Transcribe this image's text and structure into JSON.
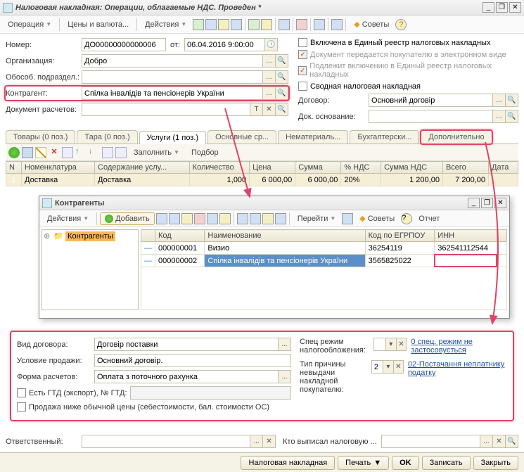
{
  "win": {
    "title": "Налоговая накладная: Операции, облагаемые НДС. Проведен *",
    "min": "_",
    "rest": "❐",
    "close": "✕"
  },
  "tb1": {
    "operation": "Операция",
    "prices": "Цены и валюта...",
    "actions": "Действия",
    "tips": "Советы"
  },
  "hdr": {
    "number_l": "Номер:",
    "number": "ДО00000000000006",
    "from_l": "от:",
    "from": "06.04.2016  9:00:00",
    "org_l": "Организация:",
    "org": "Добро",
    "obosob_l": "Обособ. подраздел.:",
    "obosob": "",
    "contr_l": "Контрагент:",
    "contr": "Спілка інвалідів та пенсіонерів України",
    "docr_l": "Документ расчетов:",
    "docr": "",
    "cb1": "Включена в Единый реестр налоговых накладных",
    "cb2": "Документ передается покупателю в электронном виде",
    "cb3": "Подлежит включению в Единый реестр налоговых накладных",
    "cb4": "Сводная налоговая накладная",
    "dog_l": "Договор:",
    "dog": "Основний договір",
    "doco_l": "Док. основание:",
    "doco": ""
  },
  "tabs": {
    "t1": "Товары (0 поз.)",
    "t2": "Тара (0 поз.)",
    "t3": "Услуги (1 поз.)",
    "t4": "Основные ср...",
    "t5": "Нематериаль...",
    "t6": "Бухгалтерски...",
    "t7": "Дополнительно"
  },
  "gbar": {
    "fill": "Заполнить",
    "sel": "Подбор"
  },
  "gh": {
    "n": "N",
    "nom": "Номенклатура",
    "cont": "Содержание услу...",
    "qty": "Количество",
    "price": "Цена",
    "sum": "Сумма",
    "vat": "% НДС",
    "vats": "Сумма НДС",
    "total": "Всего",
    "date": "Дата"
  },
  "gr": {
    "n": "1",
    "nom": "Доставка",
    "cont": "Доставка",
    "qty": "1,000",
    "price": "6 000,00",
    "sum": "6 000,00",
    "vat": "20%",
    "vats": "1 200,00",
    "total": "7 200,00"
  },
  "sub": {
    "title": "Контрагенты",
    "actions": "Действия",
    "add": "Добавить",
    "goto": "Перейти",
    "tips": "Советы",
    "report": "Отчет",
    "tree": "Контрагенты",
    "h_code": "Код",
    "h_name": "Наименование",
    "h_edrpou": "Код по ЕГРПОУ",
    "h_inn": "ИНН",
    "r1_code": "000000001",
    "r1_name": "Визио",
    "r1_edrpou": "36254119",
    "r1_inn": "362541112544",
    "r2_code": "000000002",
    "r2_name": "Спілка інвалідів та пенсіонерів України",
    "r2_edrpou": "3565825022",
    "r2_inn": ""
  },
  "bt": {
    "vd_l": "Вид договора:",
    "vd": "Договір поставки",
    "up_l": "Условие продажи:",
    "up": "Основний договір.",
    "fr_l": "Форма расчетов:",
    "fr": "Оплата з поточного рахунка",
    "gtd_cb": "Есть ГТД (экспорт), № ГТД:",
    "low_cb": "Продажа ниже обычной цены (себестоимости, бал. стоимости ОС)",
    "spec_l": "Спец режим налогообложения:",
    "spec_link": "0   спец. режим не застосовується",
    "typ_l": "Тип причины невыдачи накладной покупателю:",
    "typ_v": "2",
    "typ_link": "02-Постачання неплатнику податку"
  },
  "resp": {
    "l1": "Ответственный:",
    "l2": "Кто выписал налоговую ..."
  },
  "ft": {
    "b1": "Налоговая накладная",
    "b2": "Печать",
    "b3": "OK",
    "b4": "Записать",
    "b5": "Закрыть"
  }
}
